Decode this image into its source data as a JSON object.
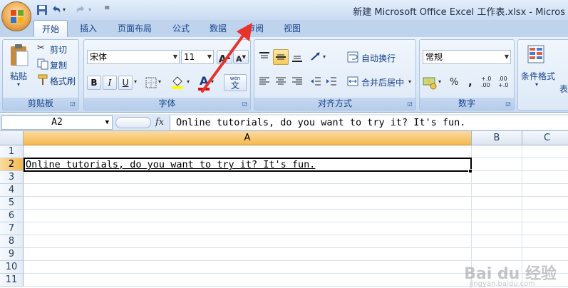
{
  "window": {
    "title": "新建 Microsoft Office Excel 工作表.xlsx - Micros"
  },
  "tabs": [
    {
      "label": "开始",
      "active": true
    },
    {
      "label": "插入"
    },
    {
      "label": "页面布局"
    },
    {
      "label": "公式"
    },
    {
      "label": "数据"
    },
    {
      "label": "审阅"
    },
    {
      "label": "视图"
    }
  ],
  "ribbon": {
    "clipboard": {
      "paste": "粘贴",
      "cut": "剪切",
      "copy": "复制",
      "format_painter": "格式刷",
      "label": "剪贴板"
    },
    "font": {
      "font_name": "宋体",
      "font_size": "11",
      "bold": "B",
      "italic": "I",
      "underline": "U",
      "font_color_glyph": "A",
      "wen": "wén",
      "wen_char": "文",
      "grow": "A",
      "shrink": "A",
      "label": "字体"
    },
    "alignment": {
      "wrap_text": "自动换行",
      "merge_center": "合并后居中",
      "label": "对齐方式"
    },
    "number": {
      "format": "常规",
      "percent": "%",
      "comma": ",",
      "inc_decimal": "+.0 .00",
      "dec_decimal": ".00 +.0",
      "label": "数字"
    },
    "styles": {
      "conditional_format": "条件格式",
      "table_partial": "表"
    }
  },
  "formula_bar": {
    "name_box": "A2",
    "fx": "fx",
    "content": "Online tutorials, do you want to try it? It's fun."
  },
  "sheet": {
    "columns": [
      "A",
      "B",
      "C"
    ],
    "selected_column": "A",
    "rows": [
      "1",
      "2",
      "3",
      "4",
      "5",
      "6",
      "7",
      "8",
      "9",
      "10",
      "11"
    ],
    "selected_row": "2",
    "active_cell": "A2",
    "active_cell_value": "Online tutorials, do you want to try it? It's fun."
  },
  "watermark": {
    "brand": "Bai du 经验",
    "url": "jingyan.baidu.com"
  },
  "colors": {
    "accent": "#15428b",
    "arrow": "#e8322c",
    "selected_header": "#f5b94f"
  }
}
